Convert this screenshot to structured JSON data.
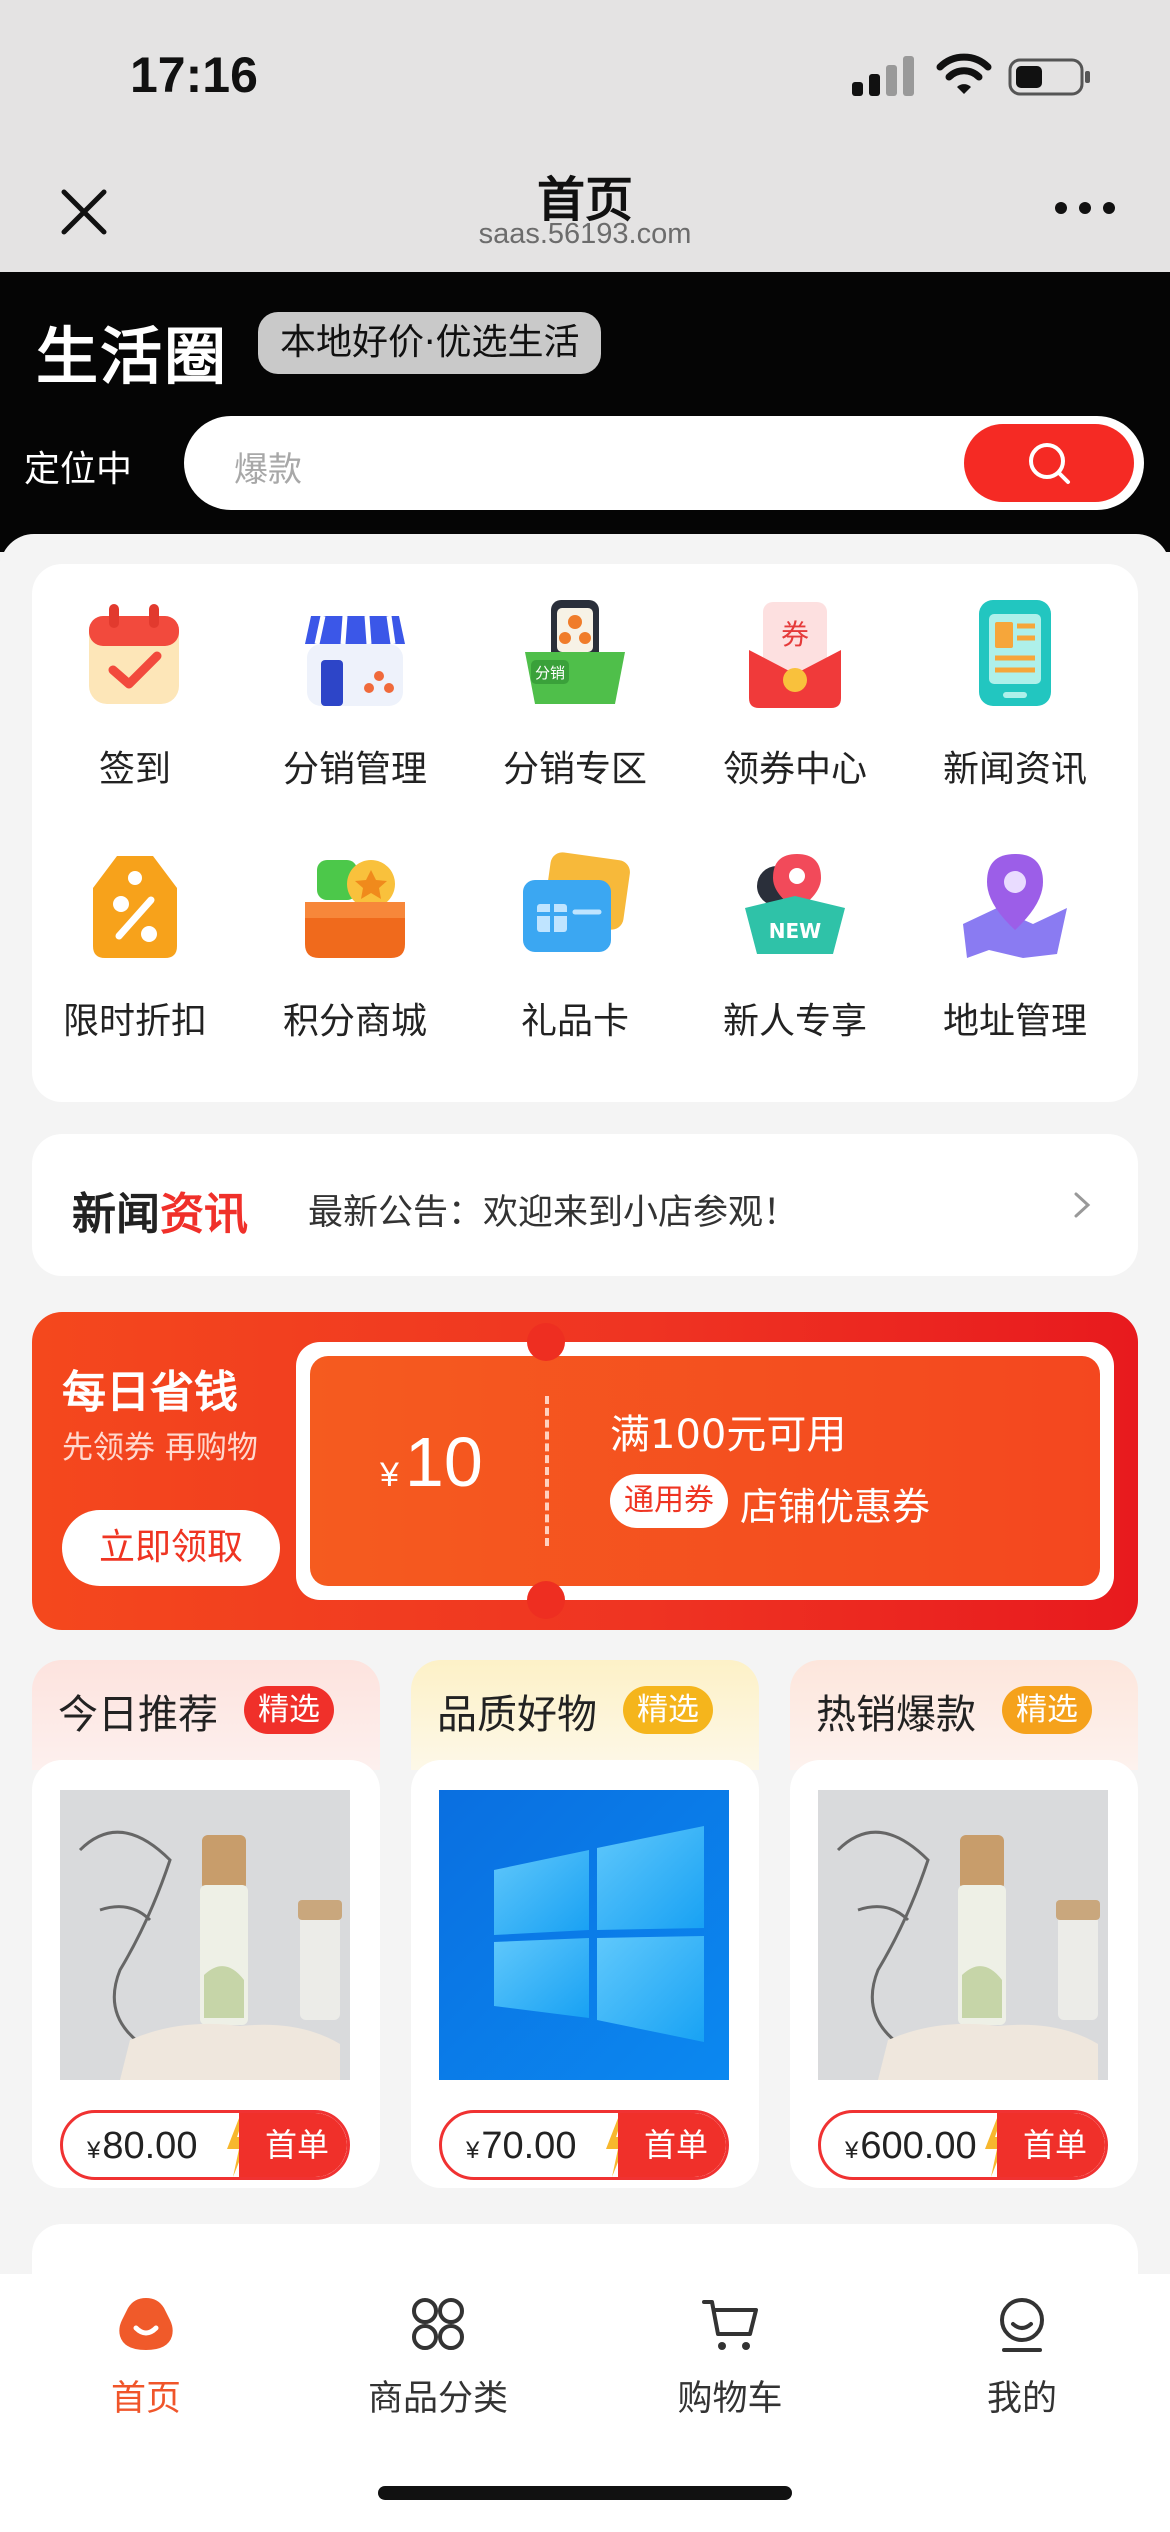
{
  "status_bar": {
    "time": "17:16"
  },
  "browser": {
    "title": "首页",
    "url": "saas.56193.com"
  },
  "banner": {
    "logo": "生活圈",
    "slogan": "本地好价·优选生活",
    "location": "定位中",
    "search_placeholder": "爆款"
  },
  "grid": [
    {
      "label": "签到",
      "icon": "calendar-check-icon"
    },
    {
      "label": "分销管理",
      "icon": "store-icon"
    },
    {
      "label": "分销专区",
      "icon": "distribution-basket-icon"
    },
    {
      "label": "领券中心",
      "icon": "coupon-envelope-icon"
    },
    {
      "label": "新闻资讯",
      "icon": "news-tablet-icon"
    },
    {
      "label": "限时折扣",
      "icon": "discount-tag-icon"
    },
    {
      "label": "积分商城",
      "icon": "points-box-icon"
    },
    {
      "label": "礼品卡",
      "icon": "gift-card-icon"
    },
    {
      "label": "新人专享",
      "icon": "new-user-icon"
    },
    {
      "label": "地址管理",
      "icon": "location-map-icon"
    }
  ],
  "news": {
    "logo_a": "新闻",
    "logo_b": "资讯",
    "text": "最新公告：欢迎来到小店参观！"
  },
  "coupon": {
    "title": "每日省钱",
    "subtitle": "先领券 再购物",
    "button": "立即领取",
    "currency": "¥",
    "amount": "10",
    "condition": "满100元可用",
    "tag": "通用券",
    "type": "店铺优惠券"
  },
  "products": [
    {
      "title": "今日推荐",
      "badge": "精选",
      "currency": "¥",
      "price": "80.00",
      "first_order": "首单"
    },
    {
      "title": "品质好物",
      "badge": "精选",
      "currency": "¥",
      "price": "70.00",
      "first_order": "首单"
    },
    {
      "title": "热销爆款",
      "badge": "精选",
      "currency": "¥",
      "price": "600.00",
      "first_order": "首单"
    }
  ],
  "tabbar": [
    {
      "label": "首页",
      "active": true
    },
    {
      "label": "商品分类",
      "active": false
    },
    {
      "label": "购物车",
      "active": false
    },
    {
      "label": "我的",
      "active": false
    }
  ],
  "colors": {
    "accent": "#f0302a",
    "orange": "#f4471f",
    "tab_active": "#f0552a"
  }
}
